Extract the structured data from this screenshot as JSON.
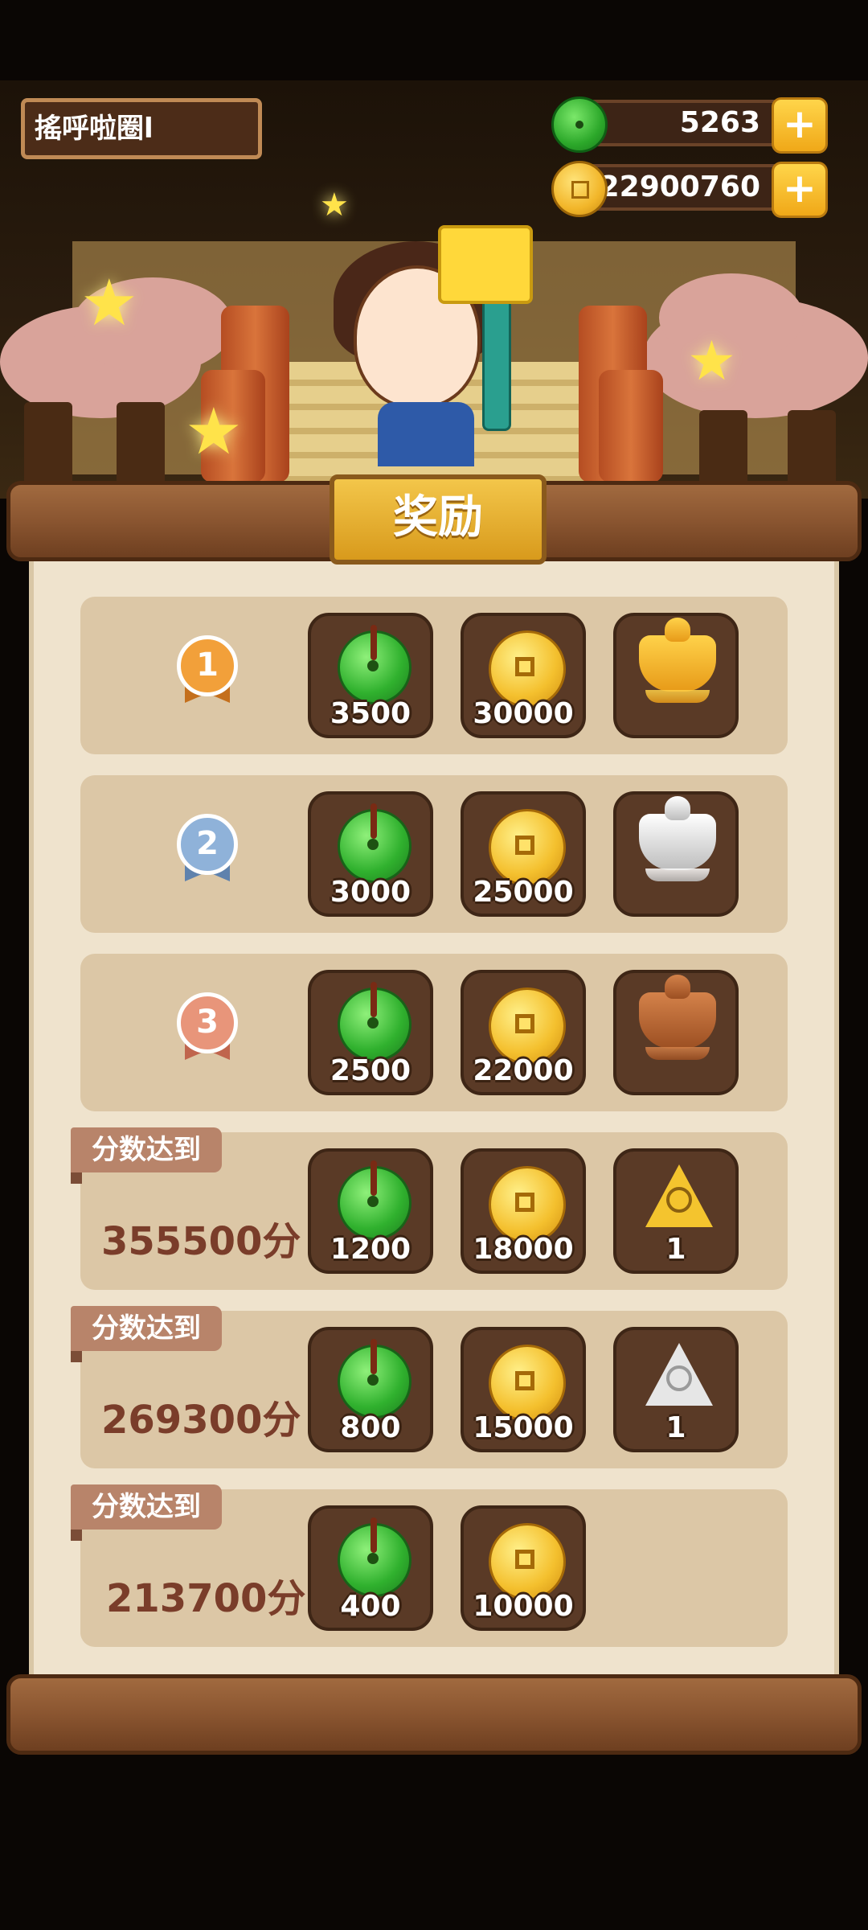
{
  "header": {
    "name": "搖呼啦圈l",
    "jade_amount": "5263",
    "coin_amount": "22900760",
    "plus": "+"
  },
  "title": "奖励",
  "rank_rows": [
    {
      "rank": "1",
      "jade": "3500",
      "coin": "30000",
      "item": "gold-censer"
    },
    {
      "rank": "2",
      "jade": "3000",
      "coin": "25000",
      "item": "silver-censer"
    },
    {
      "rank": "3",
      "jade": "2500",
      "coin": "22000",
      "item": "bronze-censer"
    }
  ],
  "score_rows": [
    {
      "tag": "分数达到",
      "score": "355500分",
      "jade": "1200",
      "coin": "18000",
      "item": "gold-talisman",
      "item_count": "1"
    },
    {
      "tag": "分数达到",
      "score": "269300分",
      "jade": "800",
      "coin": "15000",
      "item": "silver-talisman",
      "item_count": "1"
    },
    {
      "tag": "分数达到",
      "score": "213700分",
      "jade": "400",
      "coin": "10000"
    }
  ],
  "colors": {
    "wood": "#8a5530",
    "paper": "#efe3cd",
    "row": "#dcc7a6",
    "medal_gold": "#f2a03a",
    "medal_silver": "#8fb2d9",
    "medal_bronze": "#e8957a"
  }
}
